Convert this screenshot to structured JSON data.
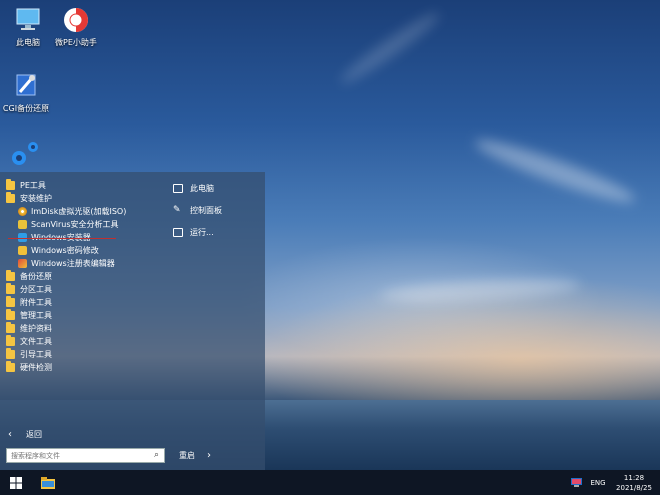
{
  "desktop": {
    "icons": [
      {
        "label": "此电脑",
        "icon": "computer-icon"
      },
      {
        "label": "微PE小助手",
        "icon": "lifebuoy-icon"
      },
      {
        "label": "CGI备份还原",
        "icon": "cgi-tool-icon"
      }
    ]
  },
  "start_menu": {
    "header_icon": "gear-icon",
    "items": [
      {
        "label": "PE工具",
        "type": "folder"
      },
      {
        "label": "安装维护",
        "type": "folder"
      },
      {
        "label": "ImDisk虚拟光驱(加载ISO)",
        "type": "app",
        "icon": "disc-icon"
      },
      {
        "label": "ScanVirus安全分析工具",
        "type": "app",
        "icon": "shield-icon"
      },
      {
        "label": "Windows安装器",
        "type": "app",
        "icon": "installer-icon"
      },
      {
        "label": "Windows密码修改",
        "type": "app",
        "icon": "key-icon"
      },
      {
        "label": "Windows注册表编辑器",
        "type": "app",
        "icon": "registry-icon"
      },
      {
        "label": "备份还原",
        "type": "folder"
      },
      {
        "label": "分区工具",
        "type": "folder"
      },
      {
        "label": "附件工具",
        "type": "folder"
      },
      {
        "label": "管理工具",
        "type": "folder"
      },
      {
        "label": "维护资料",
        "type": "folder"
      },
      {
        "label": "文件工具",
        "type": "folder"
      },
      {
        "label": "引导工具",
        "type": "folder"
      },
      {
        "label": "硬件检测",
        "type": "folder"
      }
    ],
    "right_items": [
      {
        "label": "此电脑",
        "icon": "computer-icon"
      },
      {
        "label": "控制面板",
        "icon": "wrench-icon"
      },
      {
        "label": "运行...",
        "icon": "run-icon"
      }
    ],
    "back_label": "返回",
    "search_placeholder": "搜索程序和文件",
    "restart_label": "重启"
  },
  "taskbar": {
    "language": "ENG",
    "time": "11:28",
    "date": "2021/8/25"
  }
}
